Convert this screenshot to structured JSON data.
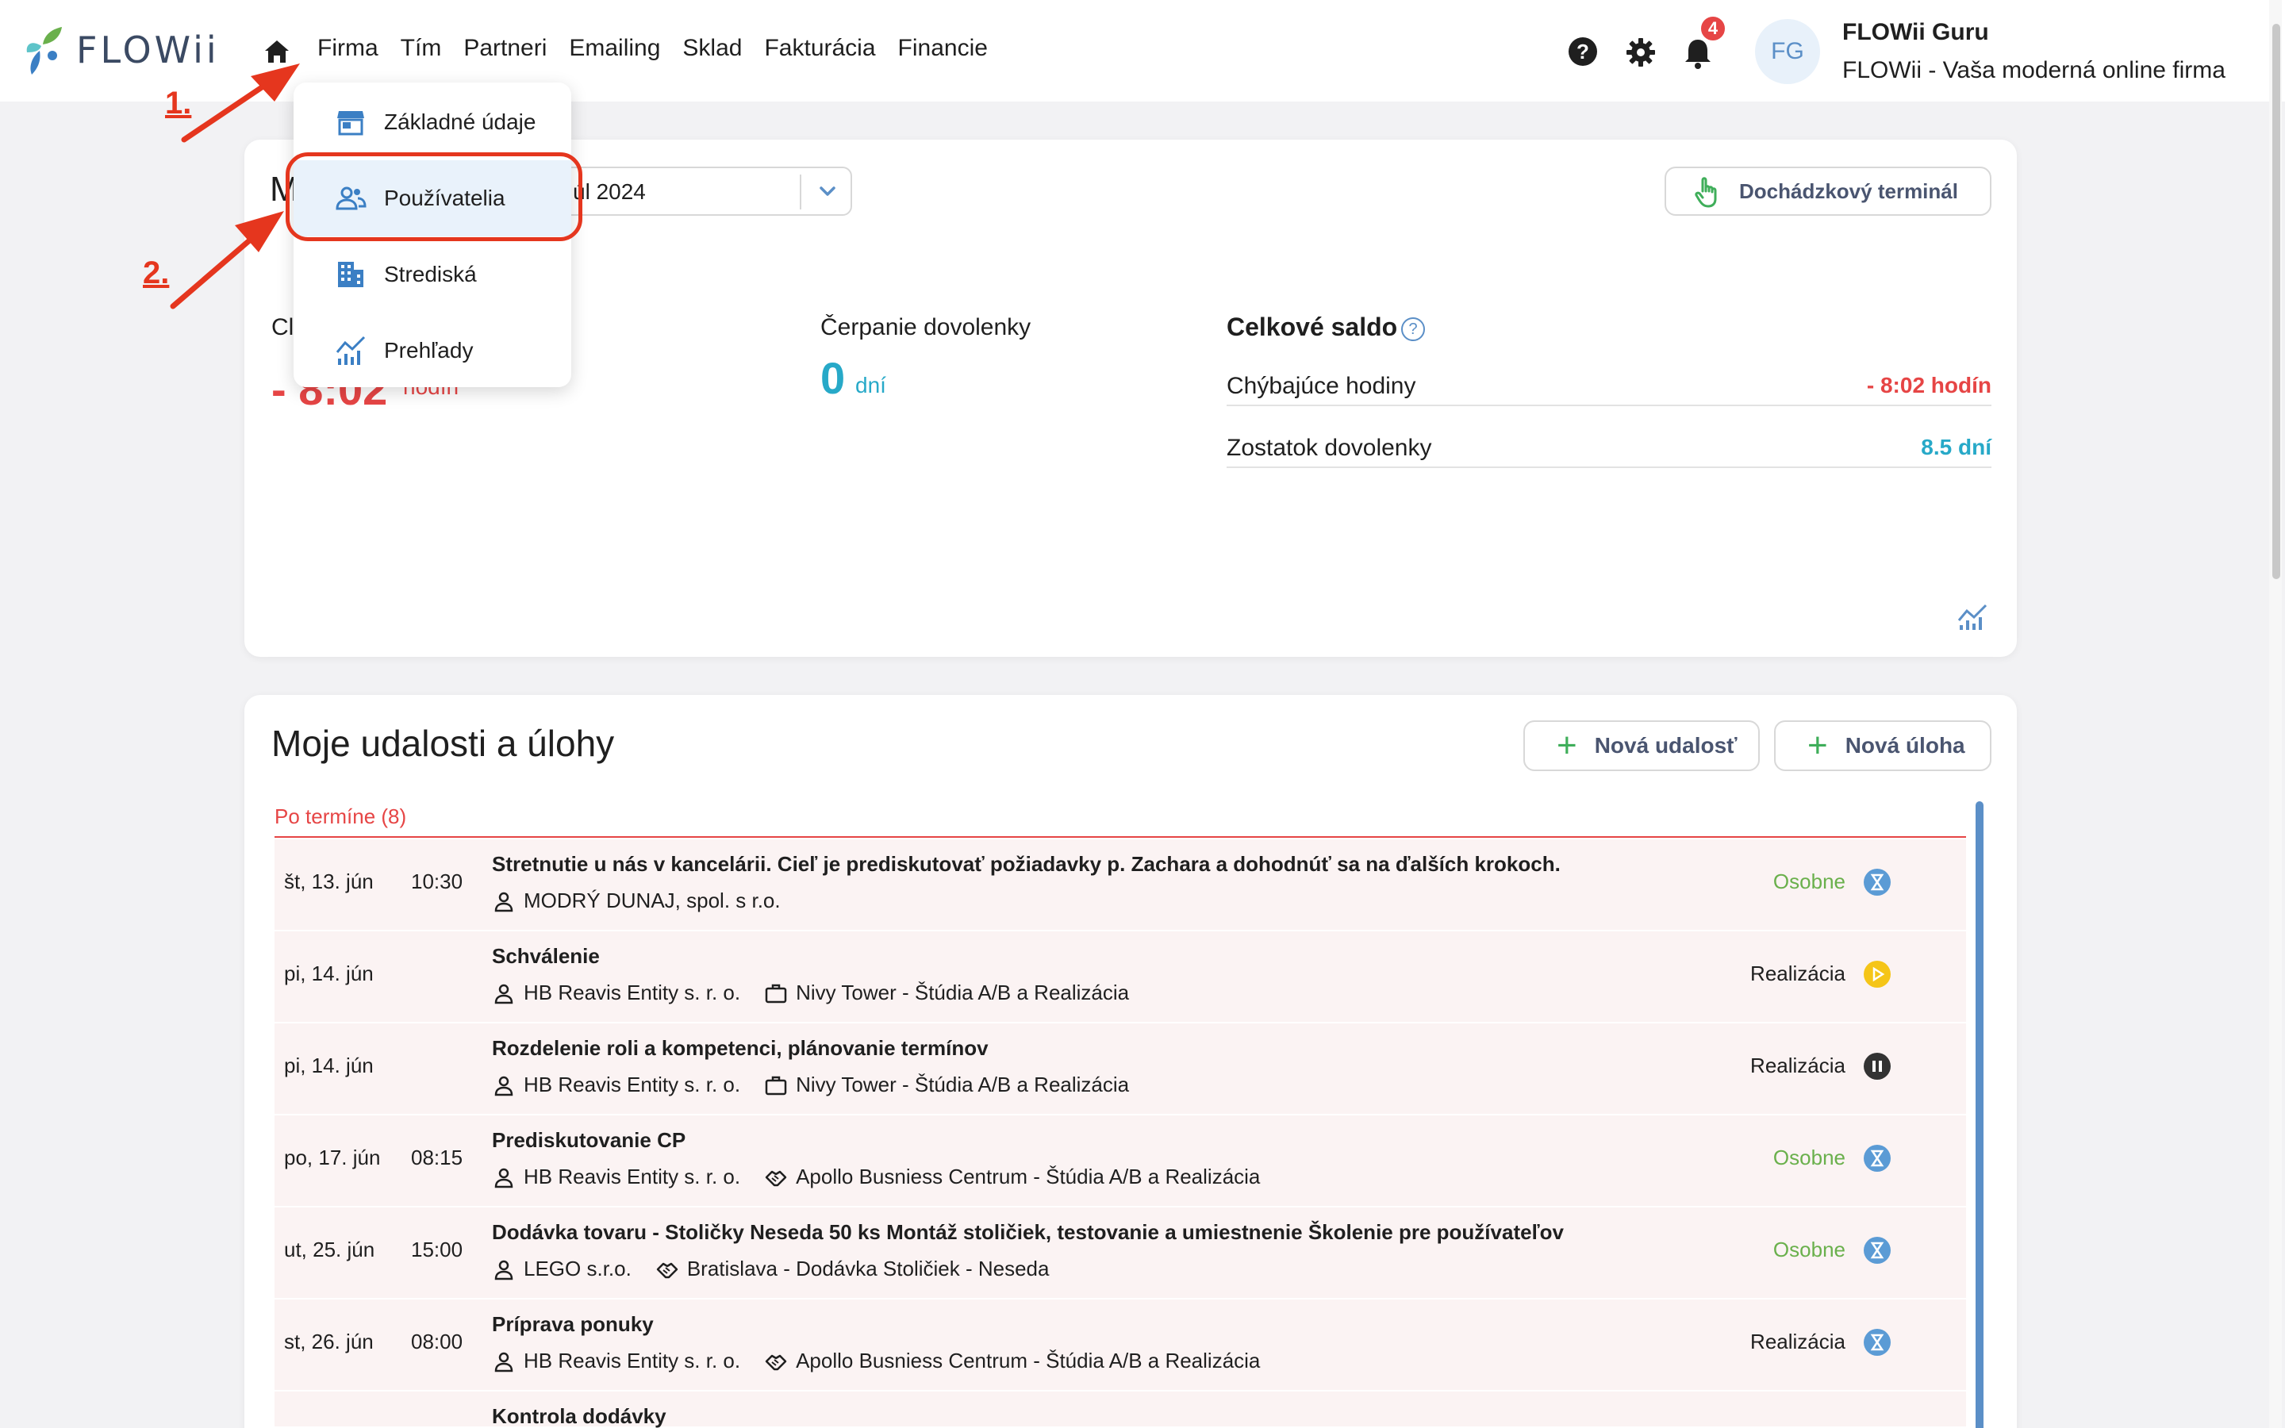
{
  "brand": {
    "name": "FLOWii"
  },
  "nav": {
    "items": [
      "Firma",
      "Tím",
      "Partneri",
      "Emailing",
      "Sklad",
      "Fakturácia",
      "Financie"
    ]
  },
  "notifications": {
    "count": "4"
  },
  "user": {
    "initials": "FG",
    "name": "FLOWii Guru",
    "company": "FLOWii - Vaša moderná online firma"
  },
  "dropdown": {
    "items": [
      "Základné údaje",
      "Používatelia",
      "Strediská",
      "Prehľady"
    ]
  },
  "annotations": {
    "step1": "1.",
    "step2": "2."
  },
  "attendance": {
    "title_partial": "M",
    "month_value": "úl 2024",
    "terminal_button": "Dochádzkový terminál",
    "left_label_partial": "Cl",
    "left_value_partial": "- 8:02",
    "left_unit_partial": "hodín",
    "vacation_label": "Čerpanie dovolenky",
    "vacation_value": "0",
    "vacation_unit": "dní",
    "balance_title": "Celkové saldo",
    "balance_help": "?",
    "missing_hours_label": "Chýbajúce hodiny",
    "missing_hours_value": "- 8:02 hodín",
    "remaining_vacation_label": "Zostatok dovolenky",
    "remaining_vacation_value": "8.5 dní",
    "colors": {
      "negative": "#e64545",
      "positive": "#27a9c8"
    }
  },
  "events": {
    "title": "Moje udalosti a úlohy",
    "new_event": "Nová udalosť",
    "new_task": "Nová úloha",
    "overdue_label": "Po termíne (8)",
    "rows": [
      {
        "date": "št, 13. jún",
        "time": "10:30",
        "title": "Stretnutie u nás v kancelárii. Cieľ je prediskutovať požiadavky p. Zachara a dohodnúť sa na ďalších krokoch.",
        "person": "MODRÝ DUNAJ, spol. s r.o.",
        "project": "",
        "project_icon": "",
        "category": "Osobne",
        "status": "hourglass-icon"
      },
      {
        "date": "pi, 14. jún",
        "time": "",
        "title": "Schválenie",
        "person": "HB Reavis Entity s. r. o.",
        "project": "Nivy Tower - Štúdia A/B a Realizácia",
        "project_icon": "briefcase-icon",
        "category": "Realizácia",
        "status": "play-icon"
      },
      {
        "date": "pi, 14. jún",
        "time": "",
        "title": "Rozdelenie roli a kompetenci, plánovanie termínov",
        "person": "HB Reavis Entity s. r. o.",
        "project": "Nivy Tower - Štúdia A/B a Realizácia",
        "project_icon": "briefcase-icon",
        "category": "Realizácia",
        "status": "pause-icon"
      },
      {
        "date": "po, 17. jún",
        "time": "08:15",
        "title": "Prediskutovanie CP",
        "person": "HB Reavis Entity s. r. o.",
        "project": "Apollo Busniess Centrum - Štúdia A/B a Realizácia",
        "project_icon": "handshake-icon",
        "category": "Osobne",
        "status": "hourglass-icon"
      },
      {
        "date": "ut, 25. jún",
        "time": "15:00",
        "title": "Dodávka tovaru - Stoličky Neseda 50 ks Montáž stoličiek, testovanie a umiestnenie Školenie pre používateľov",
        "person": "LEGO s.r.o.",
        "project": "Bratislava - Dodávka Stoličiek - Neseda",
        "project_icon": "handshake-icon",
        "category": "Osobne",
        "status": "hourglass-icon"
      },
      {
        "date": "st, 26. jún",
        "time": "08:00",
        "title": "Príprava ponuky",
        "person": "HB Reavis Entity s. r. o.",
        "project": "Apollo Busniess Centrum - Štúdia A/B a Realizácia",
        "project_icon": "handshake-icon",
        "category": "Realizácia",
        "status": "hourglass-icon"
      },
      {
        "date": "",
        "time": "",
        "title": "Kontrola dodávky",
        "person": "",
        "project": "",
        "project_icon": "",
        "category": "",
        "status": ""
      }
    ]
  }
}
